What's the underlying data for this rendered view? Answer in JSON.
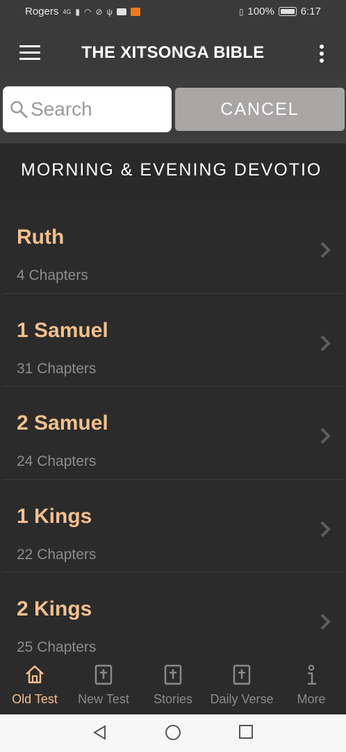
{
  "status_bar": {
    "carrier": "Rogers",
    "network": "4G",
    "battery": "100%",
    "time": "6:17"
  },
  "app_bar": {
    "title": "THE XITSONGA BIBLE"
  },
  "search": {
    "placeholder": "Search",
    "cancel_label": "CANCEL"
  },
  "banner": {
    "text": "MORNING & EVENING DEVOTIO"
  },
  "books": [
    {
      "name": "Ruth",
      "chapters": "4 Chapters"
    },
    {
      "name": "1 Samuel",
      "chapters": "31 Chapters"
    },
    {
      "name": "2 Samuel",
      "chapters": "24 Chapters"
    },
    {
      "name": "1 Kings",
      "chapters": "22 Chapters"
    },
    {
      "name": "2 Kings",
      "chapters": "25 Chapters"
    }
  ],
  "tabs": [
    {
      "label": "Old Test",
      "icon": "home-icon",
      "active": true
    },
    {
      "label": "New Test",
      "icon": "bible-icon",
      "active": false
    },
    {
      "label": "Stories",
      "icon": "bible-icon",
      "active": false
    },
    {
      "label": "Daily Verse",
      "icon": "bible-icon",
      "active": false
    },
    {
      "label": "More",
      "icon": "info-icon",
      "active": false
    }
  ],
  "colors": {
    "accent": "#f2c08d",
    "background": "#2b2b2b",
    "app_bar": "#3a3a3a",
    "cancel_button": "#a9a6a6"
  }
}
